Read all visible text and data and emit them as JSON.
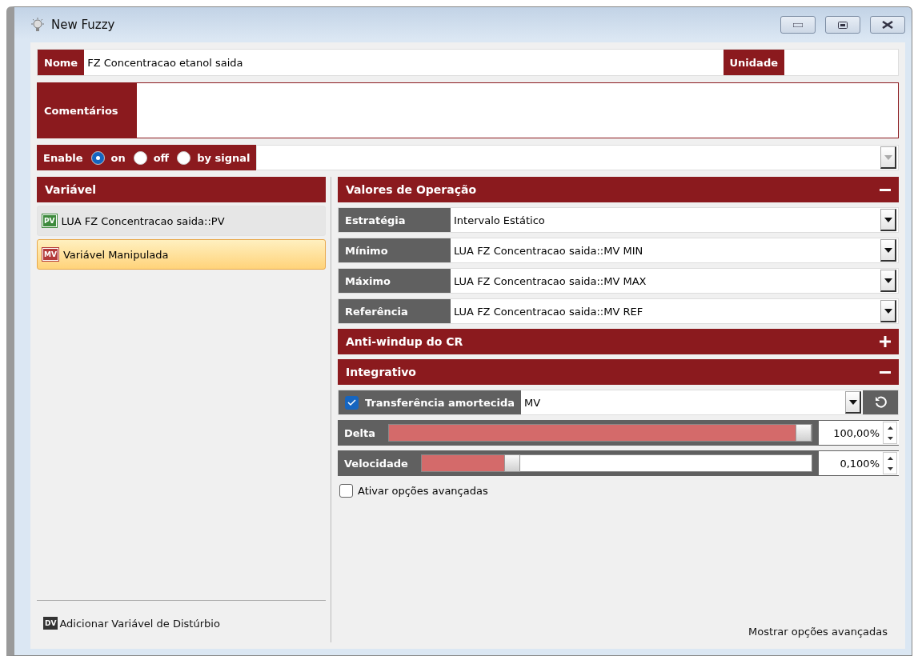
{
  "window": {
    "title": "New Fuzzy"
  },
  "nome": {
    "label": "Nome",
    "value": "FZ Concentracao etanol saida"
  },
  "unidade": {
    "label": "Unidade"
  },
  "comentarios": {
    "label": "Comentários"
  },
  "enable": {
    "label": "Enable",
    "options": [
      {
        "label": "on",
        "selected": true
      },
      {
        "label": "off",
        "selected": false
      },
      {
        "label": "by signal",
        "selected": false
      }
    ]
  },
  "variables": {
    "header": "Variável",
    "items": [
      {
        "badge": "PV",
        "kind": "pv",
        "label": "LUA FZ Concentracao saida::PV",
        "selected": false
      },
      {
        "badge": "MV",
        "kind": "mv",
        "label": "Variável Manipulada",
        "selected": true
      }
    ],
    "add_link": {
      "badge": "DV",
      "label": "Adicionar Variável de Distúrbio"
    }
  },
  "sections": [
    {
      "title": "Valores de Operação",
      "expanded": true,
      "rows": [
        {
          "kind": "select",
          "label": "Estratégia",
          "value": "Intervalo Estático"
        },
        {
          "kind": "select",
          "label": "Mínimo",
          "value": "LUA FZ Concentracao saida::MV MIN"
        },
        {
          "kind": "select",
          "label": "Máximo",
          "value": "LUA FZ Concentracao saida::MV MAX"
        },
        {
          "kind": "select",
          "label": "Referência",
          "value": "LUA FZ Concentracao saida::MV REF"
        }
      ]
    },
    {
      "title": "Anti-windup do CR",
      "expanded": false
    },
    {
      "title": "Integrativo",
      "expanded": true,
      "rows": [
        {
          "kind": "checkselect",
          "label": "Transferência amortecida",
          "checked": true,
          "value": "MV"
        },
        {
          "kind": "slider",
          "label": "Delta",
          "level": 1.0,
          "reading": "100,00%"
        },
        {
          "kind": "slider",
          "label": "Velocidade",
          "level": 0.22,
          "reading": "0,100%"
        },
        {
          "kind": "checkbox",
          "label": "Ativar opções avançadas",
          "checked": false
        }
      ]
    }
  ],
  "footer_link": "Mostrar opções avançadas"
}
